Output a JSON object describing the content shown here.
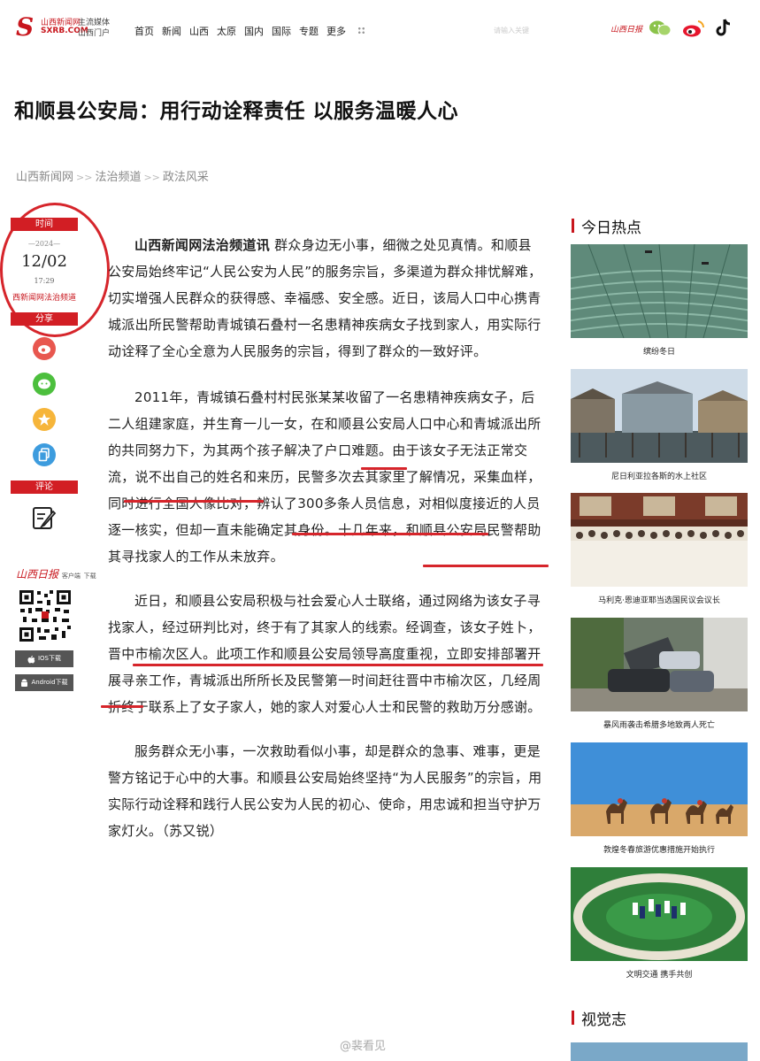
{
  "site": {
    "logo_mark": "S",
    "logo_cn": "山西新闻网",
    "logo_en": "SXRB.COM",
    "slogan_line1": "主流媒体",
    "slogan_line2": "山西门户",
    "nav": [
      "首页",
      "新闻",
      "山西",
      "太原",
      "国内",
      "国际",
      "专题",
      "更多"
    ],
    "search_placeholder": "请输入关键",
    "header_icons": [
      "shanxi-daily-logo",
      "wechat-icon",
      "weibo-icon",
      "tiktok-icon"
    ],
    "paper_label": "山西日报"
  },
  "article": {
    "title": "和顺县公安局：用行动诠释责任 以服务温暖人心",
    "breadcrumb": [
      "山西新闻网",
      "法治频道",
      "政法风采"
    ],
    "breadcrumb_sep": ">>",
    "lead_source": "山西新闻网法治频道讯",
    "paragraphs": [
      "群众身边无小事，细微之处见真情。和顺县公安局始终牢记“人民公安为人民”的服务宗旨，多渠道为群众排忧解难，切实增强人民群众的获得感、幸福感、安全感。近日，该局人口中心携青城派出所民警帮助青城镇石叠村一名患精神疾病女子找到家人，用实际行动诠释了全心全意为人民服务的宗旨，得到了群众的一致好评。",
      "2011年，青城镇石叠村村民张某某收留了一名患精神疾病女子，后二人组建家庭，并生育一儿一女，在和顺县公安局人口中心和青城派出所的共同努力下，为其两个孩子解决了户口难题。由于该女子无法正常交流，说不出自己的姓名和来历，民警多次去其家里了解情况，采集血样，同时进行全国人像比对，辨认了300多条人员信息，对相似度接近的人员逐一核实，但却一直未能确定其身份。十几年来，和顺县公安局民警帮助其寻找家人的工作从未放弃。",
      "近日，和顺县公安局积极与社会爱心人士联络，通过网络为该女子寻找家人，经过研判比对，终于有了其家人的线索。经调查，该女子姓卜，晋中市榆次区人。此项工作和顺县公安局领导高度重视，立即安排部署开展寻亲工作，青城派出所所长及民警第一时间赶往晋中市榆次区，几经周折终于联系上了女子家人，她的家人对爱心人士和民警的救助万分感谢。",
      "服务群众无小事，一次救助看似小事，却是群众的急事、难事，更是警方铭记于心中的大事。和顺县公安局始终坚持“为人民服务”的宗旨，用实际行动诠释和践行人民公安为人民的初心、使命，用忠诚和担当守护万家灯火。（苏又锐）"
    ]
  },
  "sidebar": {
    "time_label": "时间",
    "year": "—2024—",
    "month_day": "12/02",
    "time": "17:29",
    "source": "西新闻网法治频道",
    "share_label": "分享",
    "share_icons": [
      "weibo-icon",
      "wechat-icon",
      "star-icon",
      "copy-icon"
    ],
    "comment_label": "评论",
    "app_brand": "山西日报",
    "app_sub1": "客户端",
    "app_sub2": "下载",
    "ios_label": "IOS下载",
    "android_label": "Android下载"
  },
  "hot": {
    "title": "今日热点",
    "items": [
      {
        "caption": "缤纷冬日"
      },
      {
        "caption": "尼日利亚拉各斯的水上社区"
      },
      {
        "caption": "马利克·恩迪亚耶当选国民议会议长"
      },
      {
        "caption": "暴风雨袭击希腊多地致两人死亡"
      },
      {
        "caption": "敦煌冬春旅游优惠措施开始执行"
      },
      {
        "caption": "文明交通 携手共创"
      }
    ],
    "next_section": "视觉志"
  },
  "watermark": "@裴看见",
  "colors": {
    "brand_red": "#c8161d",
    "underline_red": "#d6252b"
  }
}
